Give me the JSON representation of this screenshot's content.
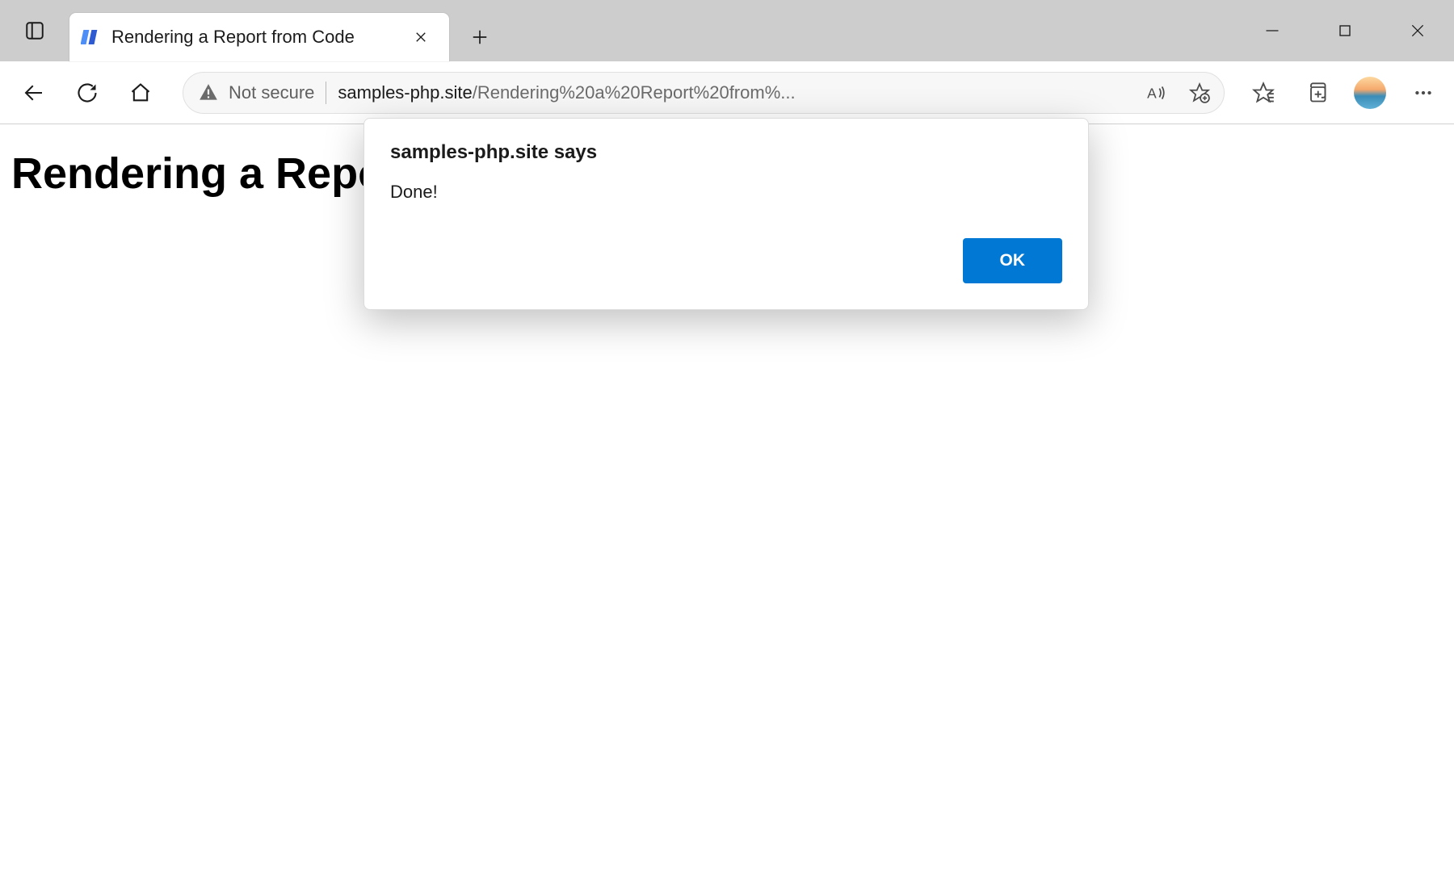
{
  "browser": {
    "tab_title": "Rendering a Report from Code",
    "security_label": "Not secure",
    "url_domain": "samples-php.site",
    "url_path": "/Rendering%20a%20Report%20from%..."
  },
  "page": {
    "heading": "Rendering a Report from Code"
  },
  "dialog": {
    "title": "samples-php.site says",
    "message": "Done!",
    "ok_label": "OK"
  }
}
